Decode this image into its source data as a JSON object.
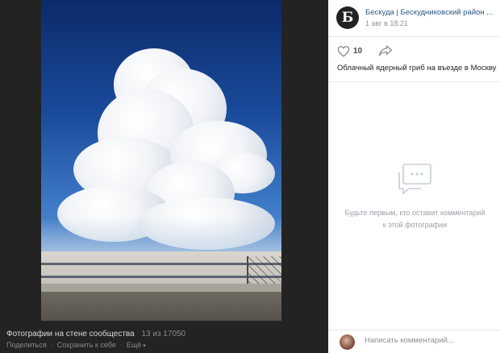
{
  "viewer": {
    "caption_title": "Фотографии на стене сообщества",
    "caption_count": "13 из 17050",
    "actions": {
      "share": "Поделиться",
      "save": "Сохранить к себе",
      "more": "Ещё"
    }
  },
  "post": {
    "group_name": "Бескуда | Бескудниковский район ...",
    "avatar_letter": "Б",
    "date": "1 авг в 18:21",
    "likes": "10",
    "description": "Облачный ядерный гриб на въезде в Москву"
  },
  "comments": {
    "empty_text": "Будьте первым, кто оставит комментарий к этой фотографии",
    "input_placeholder": "Написать комментарий..."
  },
  "colors": {
    "link": "#2a5885",
    "viewer_bg": "#232323",
    "muted": "#939393"
  },
  "icons": [
    "heart-icon",
    "share-arrow-icon",
    "comments-empty-icon"
  ]
}
